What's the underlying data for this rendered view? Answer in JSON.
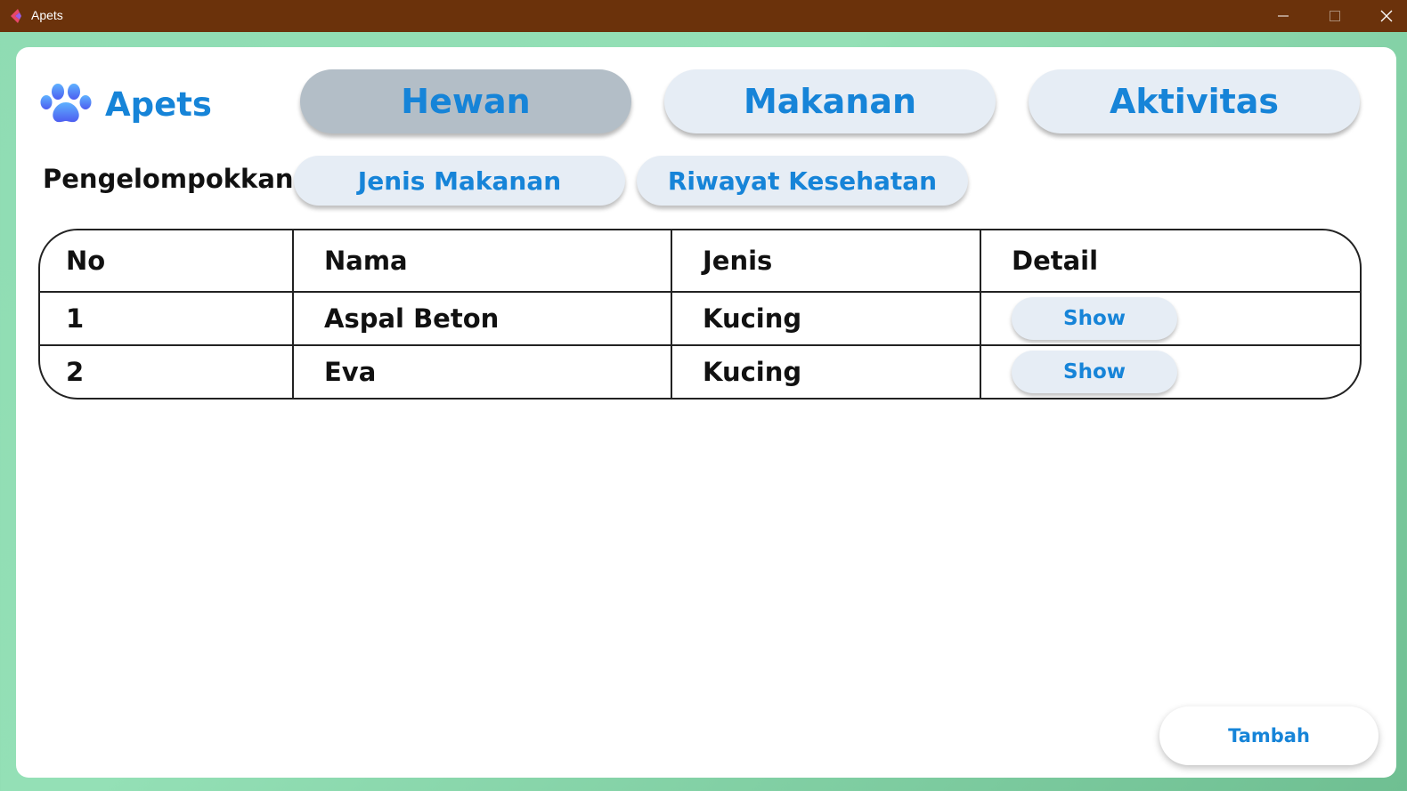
{
  "window": {
    "title": "Apets"
  },
  "brand": {
    "name": "Apets",
    "icon": "paw-icon"
  },
  "nav": {
    "tabs": [
      {
        "label": "Hewan",
        "active": true
      },
      {
        "label": "Makanan",
        "active": false
      },
      {
        "label": "Aktivitas",
        "active": false
      }
    ]
  },
  "grouping": {
    "label": "Pengelompokkan:",
    "buttons": [
      "Jenis Makanan",
      "Riwayat Kesehatan"
    ]
  },
  "table": {
    "columns": [
      "No",
      "Nama",
      "Jenis",
      "Detail"
    ],
    "rows": [
      {
        "no": "1",
        "nama": "Aspal Beton",
        "jenis": "Kucing",
        "detail": "Show"
      },
      {
        "no": "2",
        "nama": "Eva",
        "jenis": "Kucing",
        "detail": "Show"
      }
    ]
  },
  "actions": {
    "add_label": "Tambah"
  },
  "colors": {
    "accent": "#1684d8",
    "titlebar": "#6b320b",
    "active_tab": "#b3bec7",
    "button_bg": "#e6edf5"
  }
}
